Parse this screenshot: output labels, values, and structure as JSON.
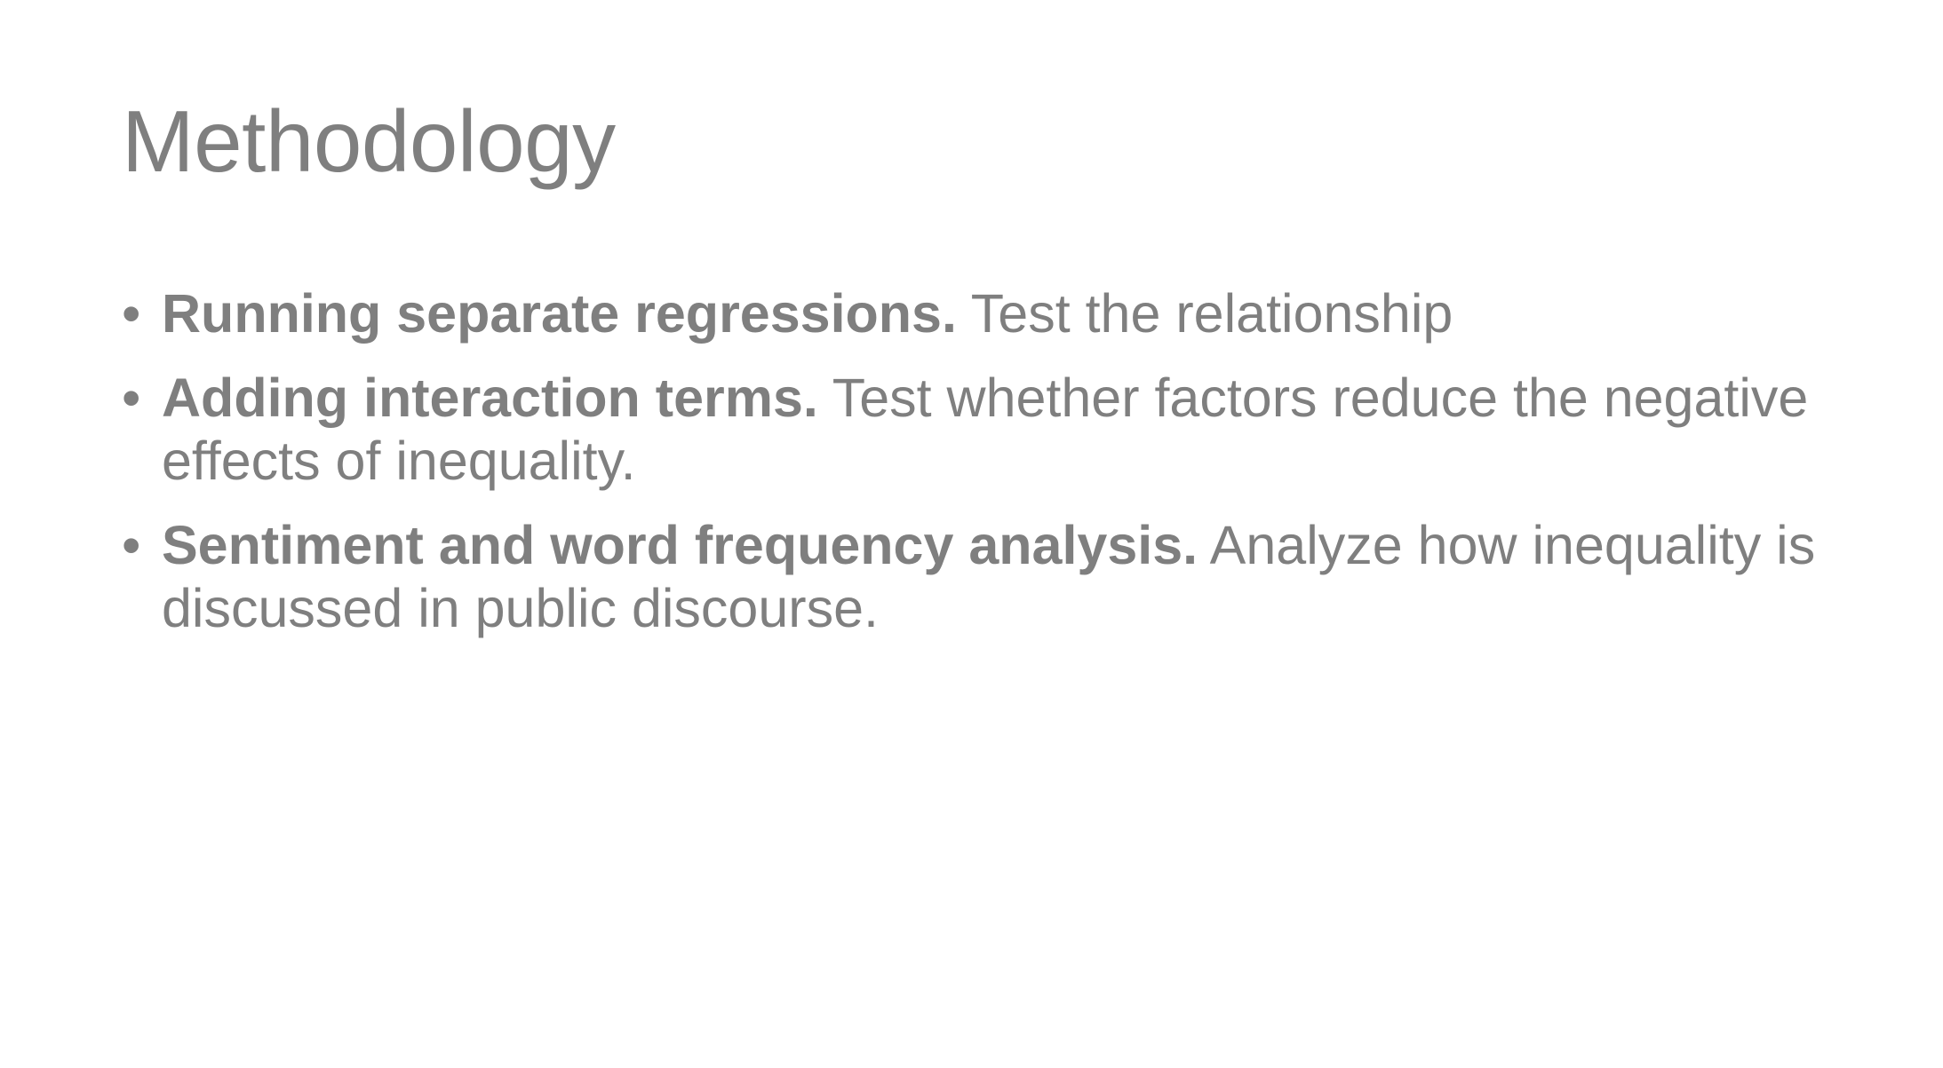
{
  "slide": {
    "title": "Methodology",
    "bullet_symbol": "•",
    "bullets": [
      {
        "strong": "Running separate regressions.",
        "text": " Test the relationship"
      },
      {
        "strong": "Adding interaction terms.",
        "text": " Test whether factors reduce the negative effects of inequality."
      },
      {
        "strong": "Sentiment and word frequency analysis.",
        "text": " Analyze how inequality is discussed in public discourse."
      }
    ]
  },
  "colors": {
    "text": "#7f7f7f",
    "background": "#ffffff"
  }
}
